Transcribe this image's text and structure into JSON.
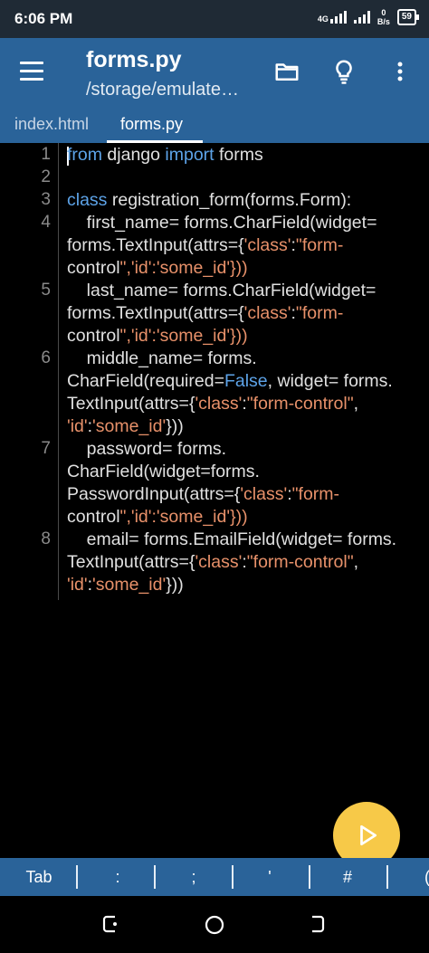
{
  "status_bar": {
    "time": "6:06 PM",
    "network_label": "4G",
    "speed_value": "0",
    "speed_unit": "B/s",
    "battery": "59"
  },
  "app_bar": {
    "title": "forms.py",
    "path": "/storage/emulate…",
    "icons": [
      "menu-icon",
      "folder-icon",
      "lightbulb-icon",
      "more-vert-icon"
    ]
  },
  "tabs": [
    {
      "label": "index.html",
      "active": false
    },
    {
      "label": "forms.py",
      "active": true
    }
  ],
  "editor": {
    "line_numbers": [
      "1",
      "2",
      "3",
      "4",
      "5",
      "6",
      "7",
      "8"
    ],
    "code_lines": [
      "from django import forms",
      "",
      "class registration_form(forms.Form):",
      "    first_name= forms.CharField(widget=",
      "forms.TextInput(attrs={'class':\"form-",
      "control\",'id':'some_id'}))",
      "    last_name= forms.CharField(widget=",
      "forms.TextInput(attrs={'class':\"form-",
      "control\",'id':'some_id'}))",
      "    middle_name= forms.",
      "CharField(required=False, widget= forms.",
      "TextInput(attrs={'class':\"form-control\",",
      "'id':'some_id'}))",
      "    password= forms.",
      "CharField(widget=forms.",
      "PasswordInput(attrs={'class':\"form-",
      "control\",'id':'some_id'}))",
      "    email= forms.EmailField(widget= forms.",
      "TextInput(attrs={'class':\"form-control\",",
      "'id':'some_id'}))"
    ]
  },
  "fab": {
    "icon": "play-icon",
    "color": "#f7c948"
  },
  "symbol_bar": [
    "Tab",
    ":",
    ";",
    "'",
    "#",
    "("
  ],
  "nav_bar": {
    "icons": [
      "recent-apps-icon",
      "home-icon",
      "back-icon"
    ]
  },
  "colors": {
    "app_bar": "#2a6399",
    "keyword": "#5da3e8",
    "string": "#e8916a",
    "text": "#e0e0e0"
  }
}
